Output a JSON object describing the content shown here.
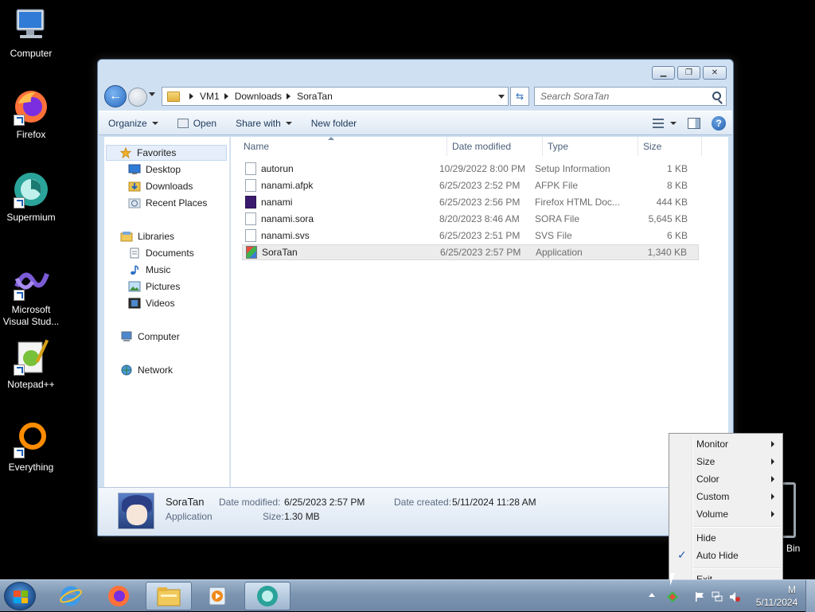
{
  "desktop": {
    "icons": [
      {
        "label": "Computer",
        "icon": "computer-icon"
      },
      {
        "label": "Firefox",
        "icon": "firefox-icon"
      },
      {
        "label": "Supermium",
        "icon": "supermium-icon"
      },
      {
        "label": "Microsoft Visual Stud...",
        "icon": "visual-studio-icon"
      },
      {
        "label": "Notepad++",
        "icon": "notepadpp-icon"
      },
      {
        "label": "Everything",
        "icon": "everything-icon"
      }
    ],
    "recycle_label": "Bin"
  },
  "explorer": {
    "address": {
      "crumbs": [
        "VM1",
        "Downloads",
        "SoraTan"
      ]
    },
    "search_placeholder": "Search SoraTan",
    "toolbar": {
      "organize": "Organize",
      "open": "Open",
      "share_with": "Share with",
      "new_folder": "New folder"
    },
    "nav": {
      "favorites": "Favorites",
      "desktop": "Desktop",
      "downloads": "Downloads",
      "recent_places": "Recent Places",
      "libraries": "Libraries",
      "documents": "Documents",
      "music": "Music",
      "pictures": "Pictures",
      "videos": "Videos",
      "computer": "Computer",
      "network": "Network"
    },
    "columns": {
      "name": "Name",
      "date_modified": "Date modified",
      "type": "Type",
      "size": "Size"
    },
    "files": [
      {
        "name": "autorun",
        "date": "10/29/2022 8:00 PM",
        "type": "Setup Information",
        "size": "1 KB"
      },
      {
        "name": "nanami.afpk",
        "date": "6/25/2023 2:52 PM",
        "type": "AFPK File",
        "size": "8 KB"
      },
      {
        "name": "nanami",
        "date": "6/25/2023 2:56 PM",
        "type": "Firefox HTML Doc...",
        "size": "444 KB"
      },
      {
        "name": "nanami.sora",
        "date": "8/20/2023 8:46 AM",
        "type": "SORA File",
        "size": "5,645 KB"
      },
      {
        "name": "nanami.svs",
        "date": "6/25/2023 2:51 PM",
        "type": "SVS File",
        "size": "6 KB"
      },
      {
        "name": "SoraTan",
        "date": "6/25/2023 2:57 PM",
        "type": "Application",
        "size": "1,340 KB"
      }
    ],
    "details": {
      "name": "SoraTan",
      "kind": "Application",
      "date_modified_label": "Date modified:",
      "date_modified": "6/25/2023 2:57 PM",
      "date_created_label": "Date created:",
      "date_created": "5/11/2024 11:28 AM",
      "size_label": "Size:",
      "size": "1.30 MB"
    }
  },
  "context_menu": {
    "items": [
      "Monitor",
      "Size",
      "Color",
      "Custom",
      "Volume"
    ],
    "hide": "Hide",
    "auto_hide": "Auto Hide",
    "exit": "Exit"
  },
  "taskbar": {
    "clock_time": "M",
    "clock_date": "5/11/2024"
  }
}
